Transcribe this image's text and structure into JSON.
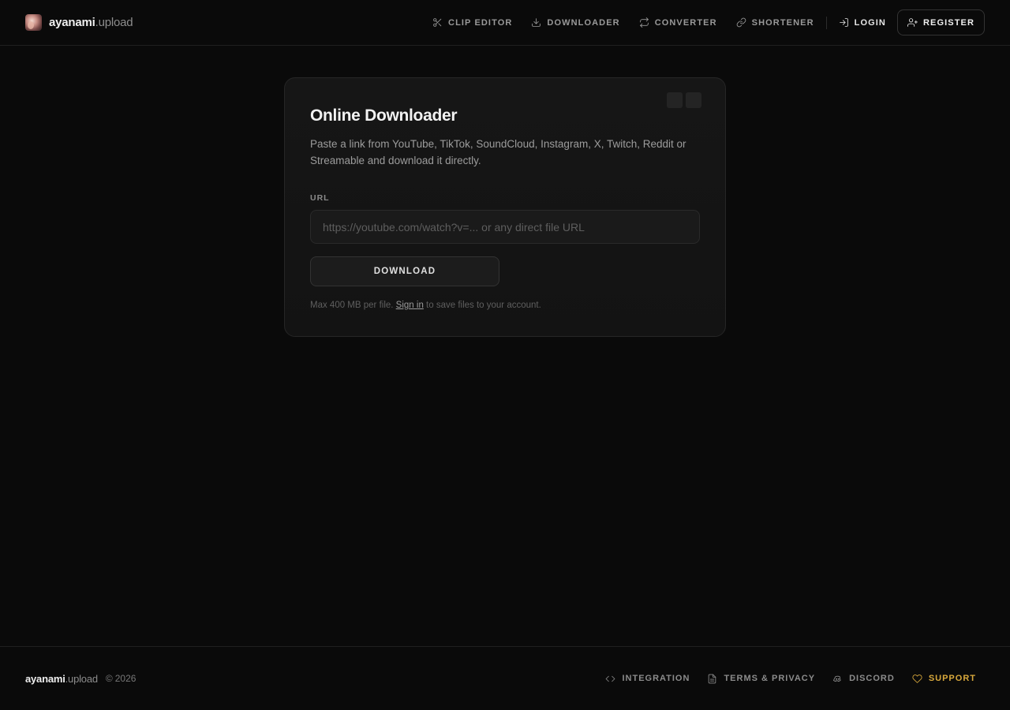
{
  "brand": {
    "name": "ayanami",
    "suffix": ".upload"
  },
  "nav": {
    "items": [
      {
        "label": "CLIP EDITOR",
        "icon": "scissors-icon"
      },
      {
        "label": "DOWNLOADER",
        "icon": "download-icon"
      },
      {
        "label": "CONVERTER",
        "icon": "repeat-icon"
      },
      {
        "label": "SHORTENER",
        "icon": "link-icon"
      }
    ],
    "login": {
      "label": "LOGIN",
      "icon": "login-icon"
    },
    "register": {
      "label": "REGISTER",
      "icon": "user-plus-icon"
    }
  },
  "card": {
    "title": "Online Downloader",
    "description": "Paste a link from YouTube, TikTok, SoundCloud, Instagram, X, Twitch, Reddit or Streamable and download it directly.",
    "url_label": "URL",
    "url_value": "",
    "url_placeholder": "https://youtube.com/watch?v=... or any direct file URL",
    "button_label": "DOWNLOAD",
    "note_prefix": "Max 400 MB per file.",
    "note_link": "Sign in",
    "note_suffix": "to save files to your account."
  },
  "footer": {
    "brand": {
      "name": "ayanami",
      "suffix": ".upload"
    },
    "copyright_symbol": "©",
    "year": "2026",
    "links": [
      {
        "label": "INTEGRATION",
        "icon": "code-icon"
      },
      {
        "label": "TERMS & PRIVACY",
        "icon": "document-icon"
      },
      {
        "label": "DISCORD",
        "icon": "discord-icon"
      },
      {
        "label": "SUPPORT",
        "icon": "heart-icon"
      }
    ]
  },
  "colors": {
    "background": "#0a0a0a",
    "card": "#151515",
    "accent_support": "#d9a93c"
  }
}
